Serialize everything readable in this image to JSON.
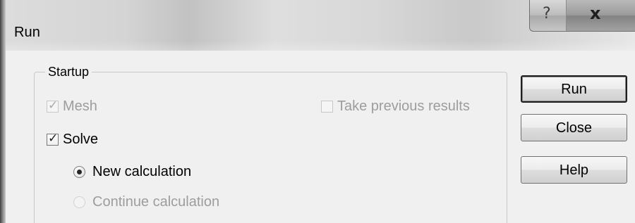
{
  "window": {
    "title": "Run",
    "help_button_label": "?",
    "close_button_label": "x"
  },
  "startup": {
    "group_label": "Startup",
    "mesh": {
      "label": "Mesh",
      "checked": true,
      "disabled": true
    },
    "take_previous_results": {
      "label": "Take previous results",
      "checked": false,
      "disabled": true
    },
    "solve": {
      "label": "Solve",
      "checked": true,
      "disabled": false
    },
    "new_calculation": {
      "label": "New calculation",
      "selected": true,
      "disabled": false
    },
    "continue_calculation": {
      "label": "Continue calculation",
      "selected": false,
      "disabled": true
    }
  },
  "actions": {
    "run_label": "Run",
    "close_label": "Close",
    "help_label": "Help"
  }
}
